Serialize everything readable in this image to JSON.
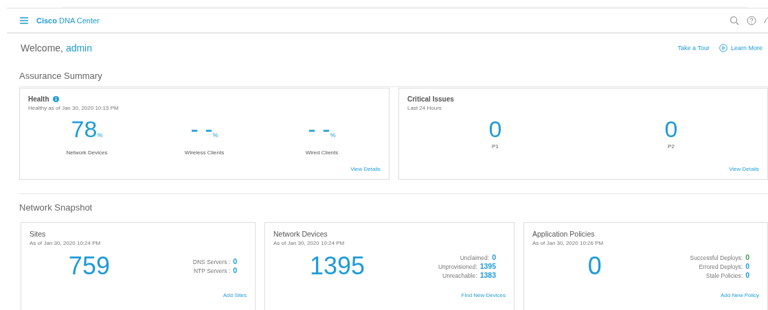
{
  "header": {
    "brand_bold": "Cisco",
    "brand": "DNA Center"
  },
  "welcome": {
    "greeting": "Welcome,",
    "user": "admin",
    "links": [
      {
        "label": "Take a Tour",
        "kind": "text"
      },
      {
        "label": "Learn More",
        "kind": "play"
      }
    ]
  },
  "assurance": {
    "title": "Assurance Summary",
    "health": {
      "title": "Health",
      "subtitle": "Healthy as of Jan 30, 2020 10:15 PM",
      "metrics": [
        {
          "value": "78",
          "unit": "%",
          "label": "Network Devices"
        },
        {
          "value": "- -",
          "unit": "%",
          "label": "Wireless Clients"
        },
        {
          "value": "- -",
          "unit": "%",
          "label": "Wired Clients"
        }
      ],
      "link": "View Details"
    },
    "critical": {
      "title": "Critical Issues",
      "subtitle": "Last 24 Hours",
      "metrics": [
        {
          "value": "0",
          "label": "P1"
        },
        {
          "value": "0",
          "label": "P2"
        }
      ],
      "link": "View Details"
    }
  },
  "snapshot": {
    "title": "Network Snapshot",
    "cards": [
      {
        "title": "Sites",
        "subtitle": "As of Jan 30, 2020 10:24 PM",
        "value": "759",
        "stats": [
          {
            "label": "DNS Servers :",
            "value": "0",
            "color": "#1e9bd7"
          },
          {
            "label": "NTP Servers :",
            "value": "0",
            "color": "#1e9bd7"
          }
        ],
        "link": "Add Sites"
      },
      {
        "title": "Network Devices",
        "subtitle": "As of Jan 30, 2020 10:24 PM",
        "value": "1395",
        "stats": [
          {
            "label": "Unclaimed:",
            "value": "0",
            "color": "#1e9bd7"
          },
          {
            "label": "Unprovisioned:",
            "value": "1395",
            "color": "#1e9bd7"
          },
          {
            "label": "Unreachable:",
            "value": "1383",
            "color": "#1e9bd7"
          }
        ],
        "link": "Find New Devices"
      },
      {
        "title": "Application Policies",
        "subtitle": "As of Jan 30, 2020 10:26 PM",
        "value": "0",
        "stats": [
          {
            "label": "Successful Deploys:",
            "value": "0",
            "color": "#3aa34a"
          },
          {
            "label": "Errored Deploys:",
            "value": "0",
            "color": "#1e9bd7"
          },
          {
            "label": "Stale Policies:",
            "value": "0",
            "color": "#1e9bd7"
          }
        ],
        "link": "Add New Policy"
      }
    ]
  }
}
